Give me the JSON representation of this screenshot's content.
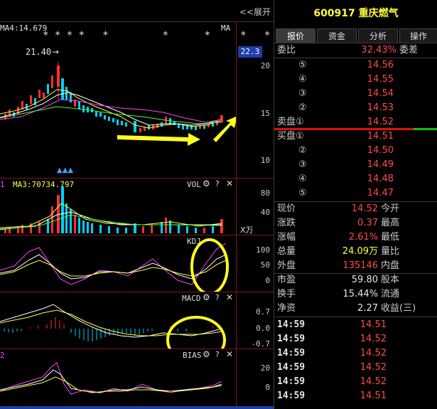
{
  "header": {
    "expand_label": "<<展开",
    "stock_code": "600917",
    "stock_name": "重庆燃气"
  },
  "tabs": [
    {
      "label": "报价",
      "active": true
    },
    {
      "label": "资金",
      "active": false
    },
    {
      "label": "分析",
      "active": false
    },
    {
      "label": "操作",
      "active": false
    }
  ],
  "price_chart": {
    "ma_label": "MA4:14.679",
    "ma_tag": "MA",
    "stars": "* * * *   *         *      *     *   *  *   *",
    "high_label": "21.40",
    "current_price_box": "22.3",
    "axis": [
      "20",
      "15",
      "10"
    ]
  },
  "volume_chart": {
    "index_label": "1",
    "ma_label": "MA3:70734.797",
    "title": "VOL",
    "axis": [
      "80",
      "40"
    ],
    "unit": "X万"
  },
  "kdj_chart": {
    "title": "KDJ",
    "axis": [
      "100",
      "50",
      "0"
    ]
  },
  "macd_chart": {
    "title": "MACD",
    "axis": [
      "0.7",
      "0.0",
      "-0.7"
    ]
  },
  "bias_chart": {
    "index_label": "2",
    "title": "BIAS",
    "axis": [
      "20",
      "0"
    ]
  },
  "order_book": {
    "ratio_label": "委比",
    "ratio_value": "32.43%",
    "diff_label": "委差",
    "asks": [
      {
        "level": "⑤",
        "price": "14.56"
      },
      {
        "level": "④",
        "price": "14.55"
      },
      {
        "level": "③",
        "price": "14.54"
      },
      {
        "level": "②",
        "price": "14.53"
      },
      {
        "level": "卖盘①",
        "price": "14.52"
      }
    ],
    "bids": [
      {
        "level": "买盘①",
        "price": "14.51"
      },
      {
        "level": "②",
        "price": "14.50"
      },
      {
        "level": "③",
        "price": "14.49"
      },
      {
        "level": "④",
        "price": "14.48"
      },
      {
        "level": "⑤",
        "price": "14.47"
      }
    ]
  },
  "quote": [
    {
      "label": "现价",
      "value": "14.52",
      "tag": "今开",
      "color": "red"
    },
    {
      "label": "涨跌",
      "value": "0.37",
      "tag": "最高",
      "color": "red"
    },
    {
      "label": "涨幅",
      "value": "2.61%",
      "tag": "最低",
      "color": "red"
    },
    {
      "label": "总量",
      "value": "24.09万",
      "tag": "量比",
      "color": "yel"
    },
    {
      "label": "外盘",
      "value": "135146",
      "tag": "内盘",
      "color": "red"
    },
    {
      "label": "市盈",
      "value": "59.80",
      "tag": "股本",
      "color": "wht"
    },
    {
      "label": "换手",
      "value": "15.44%",
      "tag": "流通",
      "color": "wht"
    },
    {
      "label": "净资",
      "value": "2.27",
      "tag": "收益(三)",
      "color": "wht"
    }
  ],
  "ticks": [
    {
      "time": "14:59",
      "price": "14.51"
    },
    {
      "time": "14:59",
      "price": "14.52"
    },
    {
      "time": "14:59",
      "price": "14.52"
    },
    {
      "time": "14:59",
      "price": "14.52"
    },
    {
      "time": "14:59",
      "price": "14.52"
    },
    {
      "time": "14:59",
      "price": "14.51"
    }
  ]
}
